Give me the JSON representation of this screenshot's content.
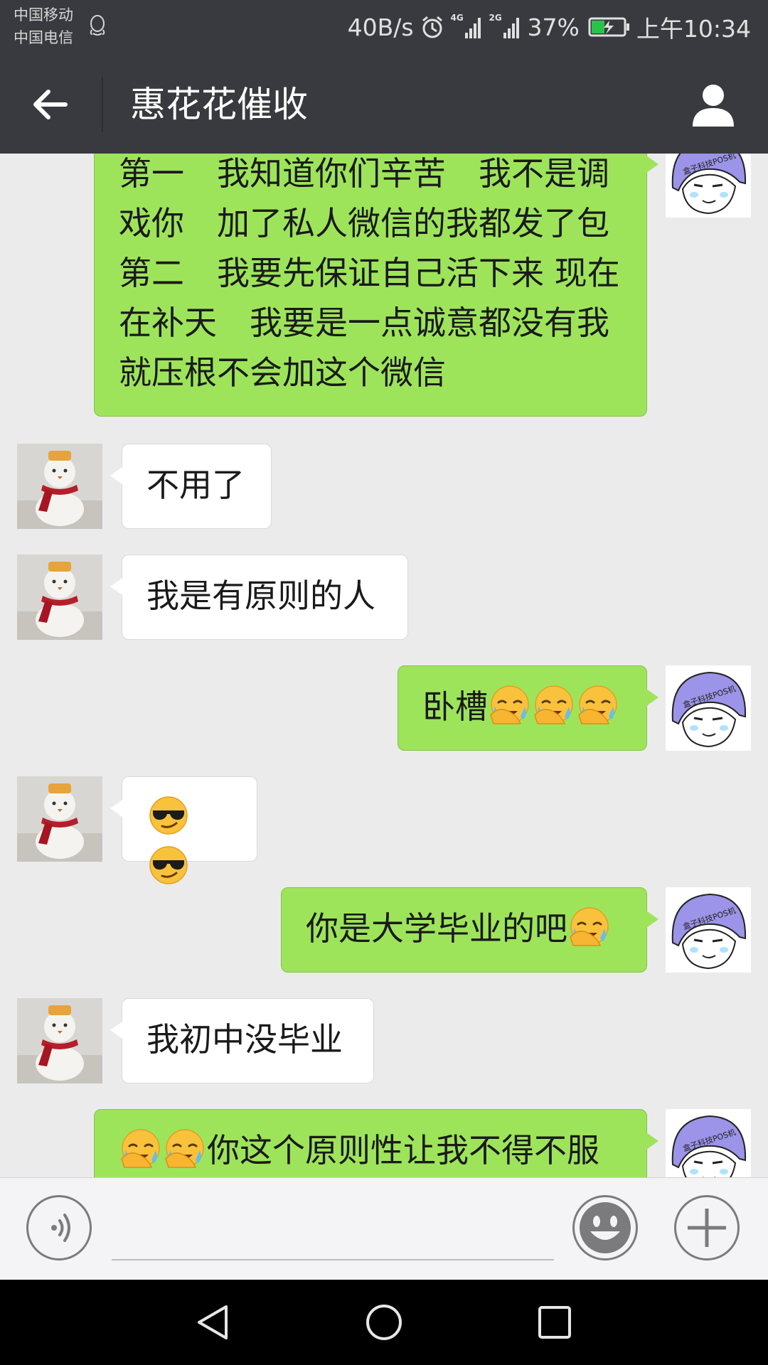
{
  "status_bar": {
    "carrier_1": "中国移动",
    "carrier_2": "中国电信",
    "net_speed": "40B/s",
    "signal_1_tag": "4G",
    "signal_2_tag": "2G",
    "battery_percent": "37%",
    "time": "上午10:34",
    "icons": [
      "qq-icon",
      "alarm-icon",
      "signal-icon",
      "battery-charging-icon"
    ]
  },
  "nav": {
    "title": "惠花花催收",
    "back_icon": "arrow-left-icon",
    "profile_icon": "person-icon"
  },
  "messages": [
    {
      "side": "out",
      "parts": [
        {
          "t": "第一　我知道你们辛苦　我不是调戏你　加了私人微信的我都发了包第二　我要先保证自己活下来 现在在补天　我要是一点诚意都没有我就压根不会加这个微信"
        }
      ]
    },
    {
      "side": "in",
      "parts": [
        {
          "t": "不用了"
        }
      ]
    },
    {
      "side": "in",
      "parts": [
        {
          "t": "我是有原则的人"
        }
      ]
    },
    {
      "side": "out",
      "parts": [
        {
          "t": "卧槽"
        },
        {
          "e": "facepalm-emoji"
        },
        {
          "e": "facepalm-emoji"
        },
        {
          "e": "facepalm-emoji"
        }
      ]
    },
    {
      "side": "in",
      "parts": [
        {
          "e": "cool-sunglasses-emoji"
        },
        {
          "e": "cool-sunglasses-emoji"
        }
      ]
    },
    {
      "side": "out",
      "parts": [
        {
          "t": "你是大学毕业的吧"
        },
        {
          "e": "facepalm-emoji"
        }
      ]
    },
    {
      "side": "in",
      "parts": [
        {
          "t": "我初中没毕业"
        }
      ]
    },
    {
      "side": "out",
      "parts": [
        {
          "e": "facepalm-emoji"
        },
        {
          "e": "facepalm-emoji"
        },
        {
          "t": "你这个原则性让我不得不服"
        }
      ]
    }
  ],
  "avatars": {
    "self": {
      "name": "helmet-cartoon-avatar",
      "helmet_text": "盒子科技POS机",
      "color": "#9b94e8"
    },
    "other": {
      "name": "snowman-avatar"
    }
  },
  "input_bar": {
    "icons": [
      "voice-icon",
      "emoji-icon",
      "plus-icon"
    ]
  },
  "system_nav": {
    "icons": [
      "back-triangle-icon",
      "home-circle-icon",
      "recents-square-icon"
    ]
  }
}
